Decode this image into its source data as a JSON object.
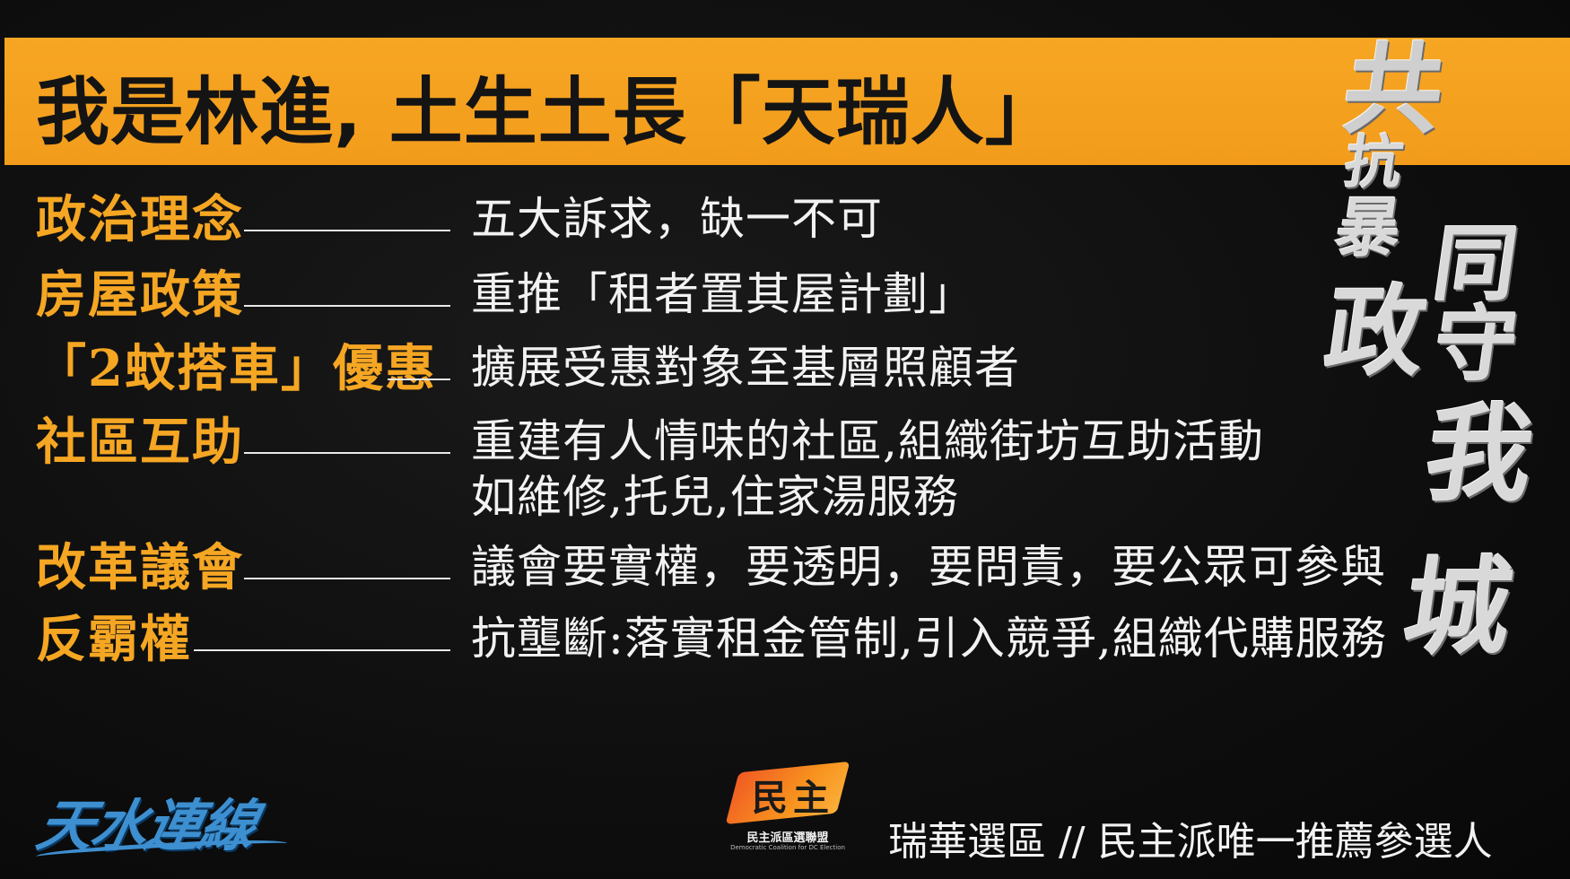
{
  "banner": {
    "title": "我是林進, 土生土長「天瑞人」"
  },
  "slogan": {
    "chars": [
      "共",
      "抗",
      "暴",
      "政",
      "同",
      "守",
      "我城"
    ]
  },
  "items": [
    {
      "label": "政治理念",
      "value": "五大訴求，缺一不可"
    },
    {
      "label": "房屋政策",
      "value": "重推「租者置其屋計劃」"
    },
    {
      "label": "「2蚊搭車」優惠",
      "value": "擴展受惠對象至基層照顧者"
    },
    {
      "label": "社區互助",
      "value": "重建有人情味的社區,組織街坊互助活動",
      "value2": "如維修,托兒,住家湯服務"
    },
    {
      "label": "改革議會",
      "value": "議會要實權，要透明，要問責，要公眾可參與"
    },
    {
      "label": "反霸權",
      "value": "抗壟斷:落實租金管制,引入競爭,組織代購服務"
    }
  ],
  "brand": {
    "name": "天水連線"
  },
  "logo": {
    "chars": [
      "民",
      "主"
    ],
    "name": "民主派區選聯盟",
    "sub": "Democratic Coalition for DC Election"
  },
  "footer": {
    "text": "瑞華選區 // 民主派唯一推薦參選人"
  }
}
